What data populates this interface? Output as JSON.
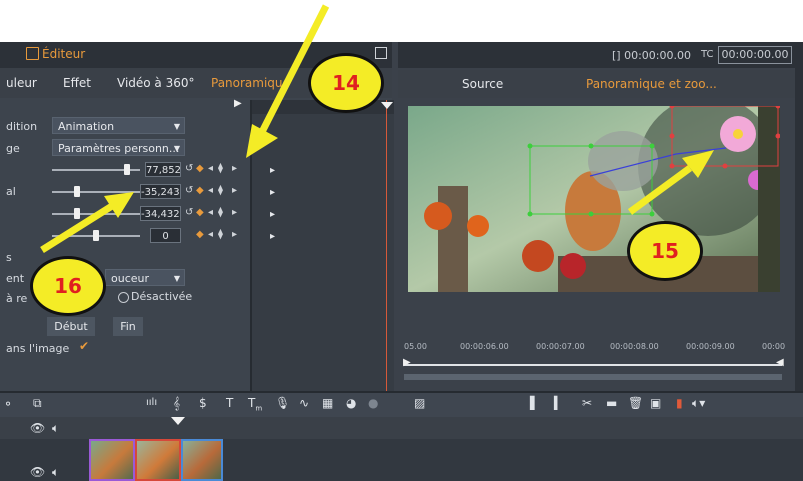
{
  "annotations": {
    "arrow14": "14",
    "arrow15": "15",
    "arrow16": "16"
  },
  "editor": {
    "title": "Éditeur",
    "tabs": [
      {
        "label": "uleur"
      },
      {
        "label": "Effet"
      },
      {
        "label": "Vidéo à 360°"
      },
      {
        "label": "Panoramique"
      }
    ],
    "row1_label": "dition",
    "row1_value": "Animation",
    "row2_label": "ge",
    "row2_value": "Paramètres personn...",
    "sliders": [
      {
        "label": "",
        "value": "77,852"
      },
      {
        "label": "al",
        "value": "-35,243"
      },
      {
        "label": "",
        "value": "-34,432"
      },
      {
        "label": "",
        "value": "0"
      }
    ],
    "section_label": "s",
    "ease_label": "ent",
    "ease_value": "ouceur",
    "radio_label": "à re",
    "radio_option": "Désactivée",
    "start_button": "Début",
    "end_button": "Fin",
    "checkbox_label": "ans l'image"
  },
  "player": {
    "timecode_left": "[] 00:00:00.00",
    "tc_label": "TC",
    "timecode_right": "00:00:00.00",
    "tab_source": "Source",
    "tab_pan": "Panoramique et zoo...",
    "ruler": [
      "05.00",
      "00:00:06.00",
      "00:00:07.00",
      "00:00:08.00",
      "00:00:09.00",
      "00:00"
    ]
  },
  "colors": {
    "accent": "#e89a3c",
    "panel": "#3b414a",
    "header": "#2f343b",
    "annotation": "#f4ec26",
    "marker_red": "#e04040",
    "marker_green": "#3ccf3c"
  }
}
